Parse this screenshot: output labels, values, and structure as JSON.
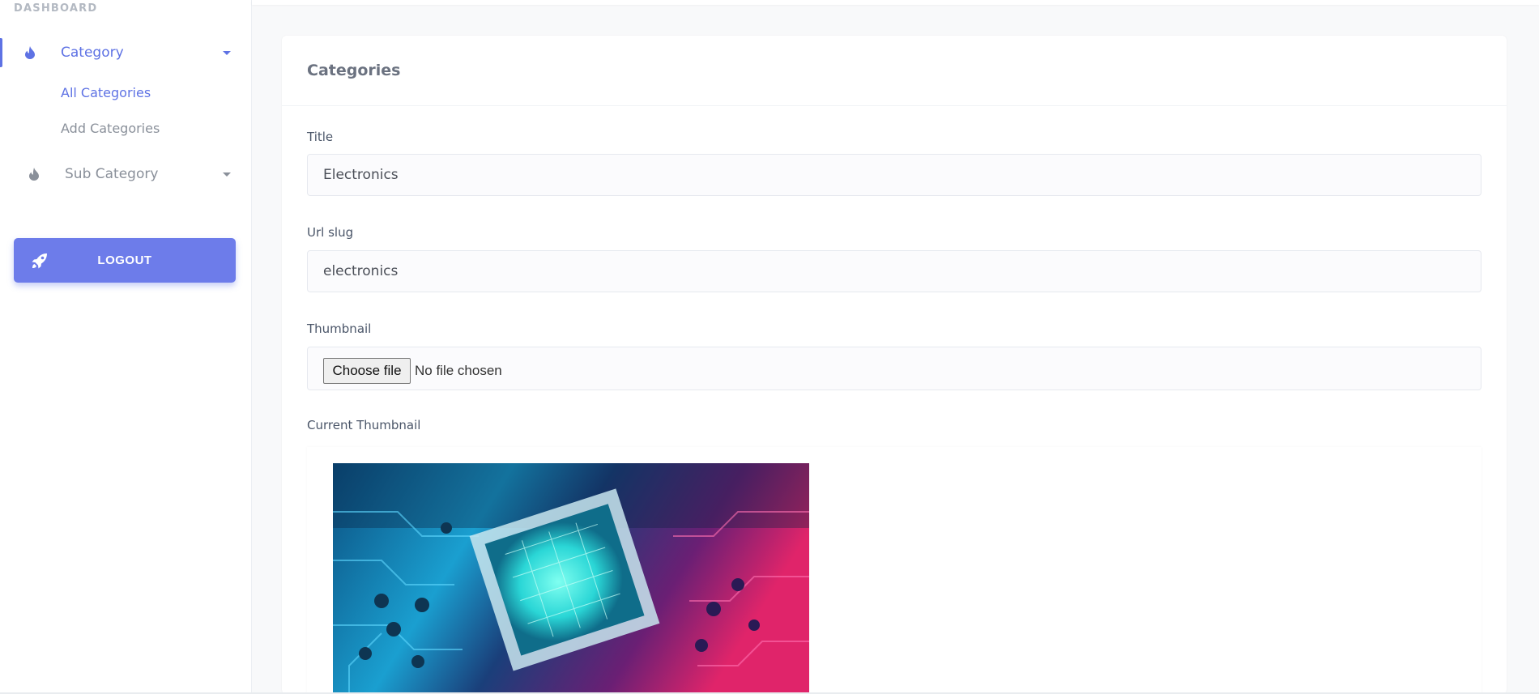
{
  "sidebar": {
    "heading": "DASHBOARD",
    "items": [
      {
        "label": "Category",
        "icon": "flame-icon",
        "active": true,
        "children": [
          {
            "label": "All Categories",
            "active": true
          },
          {
            "label": "Add Categories",
            "active": false
          }
        ]
      },
      {
        "label": "Sub Category",
        "icon": "flame-icon",
        "active": false
      }
    ],
    "logout_label": "LOGOUT"
  },
  "card": {
    "title": "Categories",
    "fields": {
      "title": {
        "label": "Title",
        "value": "Electronics"
      },
      "slug": {
        "label": "Url slug",
        "value": "electronics"
      },
      "thumbnail": {
        "label": "Thumbnail",
        "button": "Choose file",
        "status": "No file chosen"
      },
      "current_thumbnail": {
        "label": "Current Thumbnail"
      }
    }
  },
  "colors": {
    "accent": "#5e72e4",
    "logout": "#6d7cea"
  }
}
